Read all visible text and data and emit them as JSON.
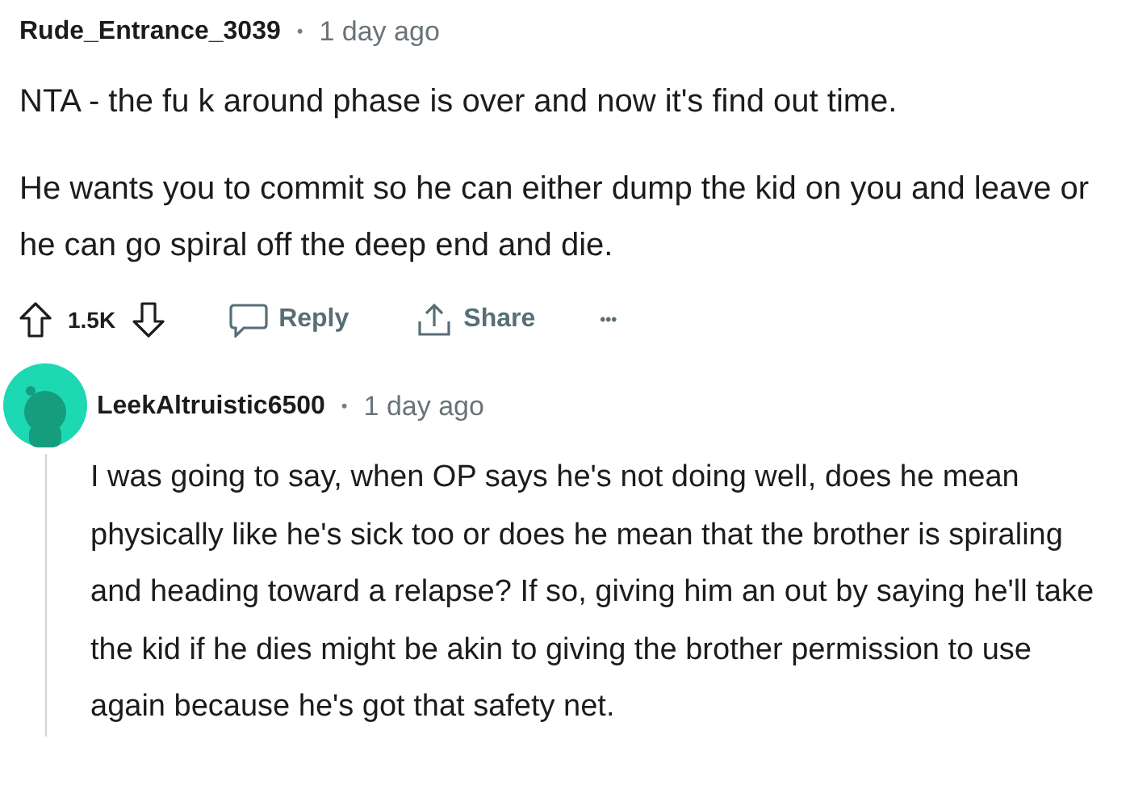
{
  "comments": [
    {
      "author": "Rude_Entrance_3039",
      "separator": "•",
      "time": "1 day ago",
      "avatar": false,
      "paragraphs": [
        "NTA - the fu k around phase is over and now it's find out time.",
        "He wants you to commit so he can either dump the kid on you and leave or he can go spiral off the deep end and die."
      ],
      "actions": {
        "score": "1.5K",
        "reply": "Reply",
        "share": "Share",
        "more": "•••"
      }
    },
    {
      "author": "LeekAltruistic6500",
      "separator": "•",
      "time": "1 day ago",
      "avatar": true,
      "paragraphs": [
        "I was going to say, when OP says he's not doing well, does he mean physically like he's sick too or does he mean that the brother is spiraling and heading toward a relapse? If so, giving him an out by saying he'll take the kid if he dies might be akin to giving the brother permission to use again because he's got that safety net."
      ]
    }
  ]
}
